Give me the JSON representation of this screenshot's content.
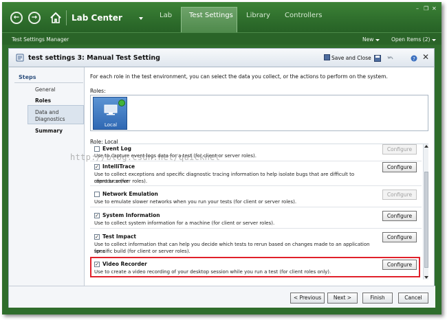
{
  "topbar": {
    "app_title": "Lab Center",
    "tabs": [
      {
        "label": "Lab"
      },
      {
        "label": "Test Settings"
      },
      {
        "label": "Library"
      },
      {
        "label": "Controllers"
      }
    ],
    "window_controls": {
      "minimize": "–",
      "restore": "❐",
      "close": "✕"
    }
  },
  "subbar": {
    "manager": "Test Settings Manager",
    "new_label": "New",
    "open_items": "Open Items (2)"
  },
  "document": {
    "title": "test settings 3: Manual Test Setting",
    "save_close": "Save and Close",
    "close": "✕"
  },
  "steps": {
    "header": "Steps",
    "items": [
      {
        "label": "General"
      },
      {
        "label": "Roles"
      },
      {
        "label": "Data and"
      },
      {
        "label": "Diagnostics"
      },
      {
        "label": "Summary"
      }
    ]
  },
  "main": {
    "intro": "For each role in the test environment, you can select the data you collect, or the actions to perform on the system.",
    "roles_label": "Roles:",
    "role_tile": "Local",
    "role_line": "Role: Local",
    "configure": "Configure",
    "items": [
      {
        "title": "Event Log",
        "checked": false,
        "desc1": "Use to capture event logs data for a test (for client or server roles).",
        "desc2": "",
        "enabled": false
      },
      {
        "title": "IntelliTrace",
        "checked": true,
        "desc1": "Use to collect exceptions and specific diagnostic tracing information to help isolate bugs that are difficult to reproduce (for",
        "desc2": "client or server roles).",
        "enabled": true
      },
      {
        "title": "Network Emulation",
        "checked": false,
        "desc1": "Use to emulate slower networks when you run your tests (for client or server roles).",
        "desc2": "",
        "enabled": false
      },
      {
        "title": "System Information",
        "checked": true,
        "desc1": "Use to collect system information for a machine (for client or server roles).",
        "desc2": "",
        "enabled": true
      },
      {
        "title": "Test Impact",
        "checked": true,
        "desc1": "Use to collect information that can help you decide which tests to rerun based on changes made to an application for a",
        "desc2": "specific build (for client or server roles).",
        "enabled": true
      },
      {
        "title": "Video Recorder",
        "checked": true,
        "desc1": "Use to create a video recording of your desktop session while you run a test (for client roles only).",
        "desc2": "",
        "enabled": true
      }
    ]
  },
  "watermark": "http://blog.csdn.net/quicknet",
  "footer": {
    "previous": "< Previous",
    "next": "Next >",
    "finish": "Finish",
    "cancel": "Cancel"
  },
  "colors": {
    "header_green": "#2f6d2c",
    "highlight_red": "#e0202a",
    "role_blue": "#2f68b3"
  }
}
